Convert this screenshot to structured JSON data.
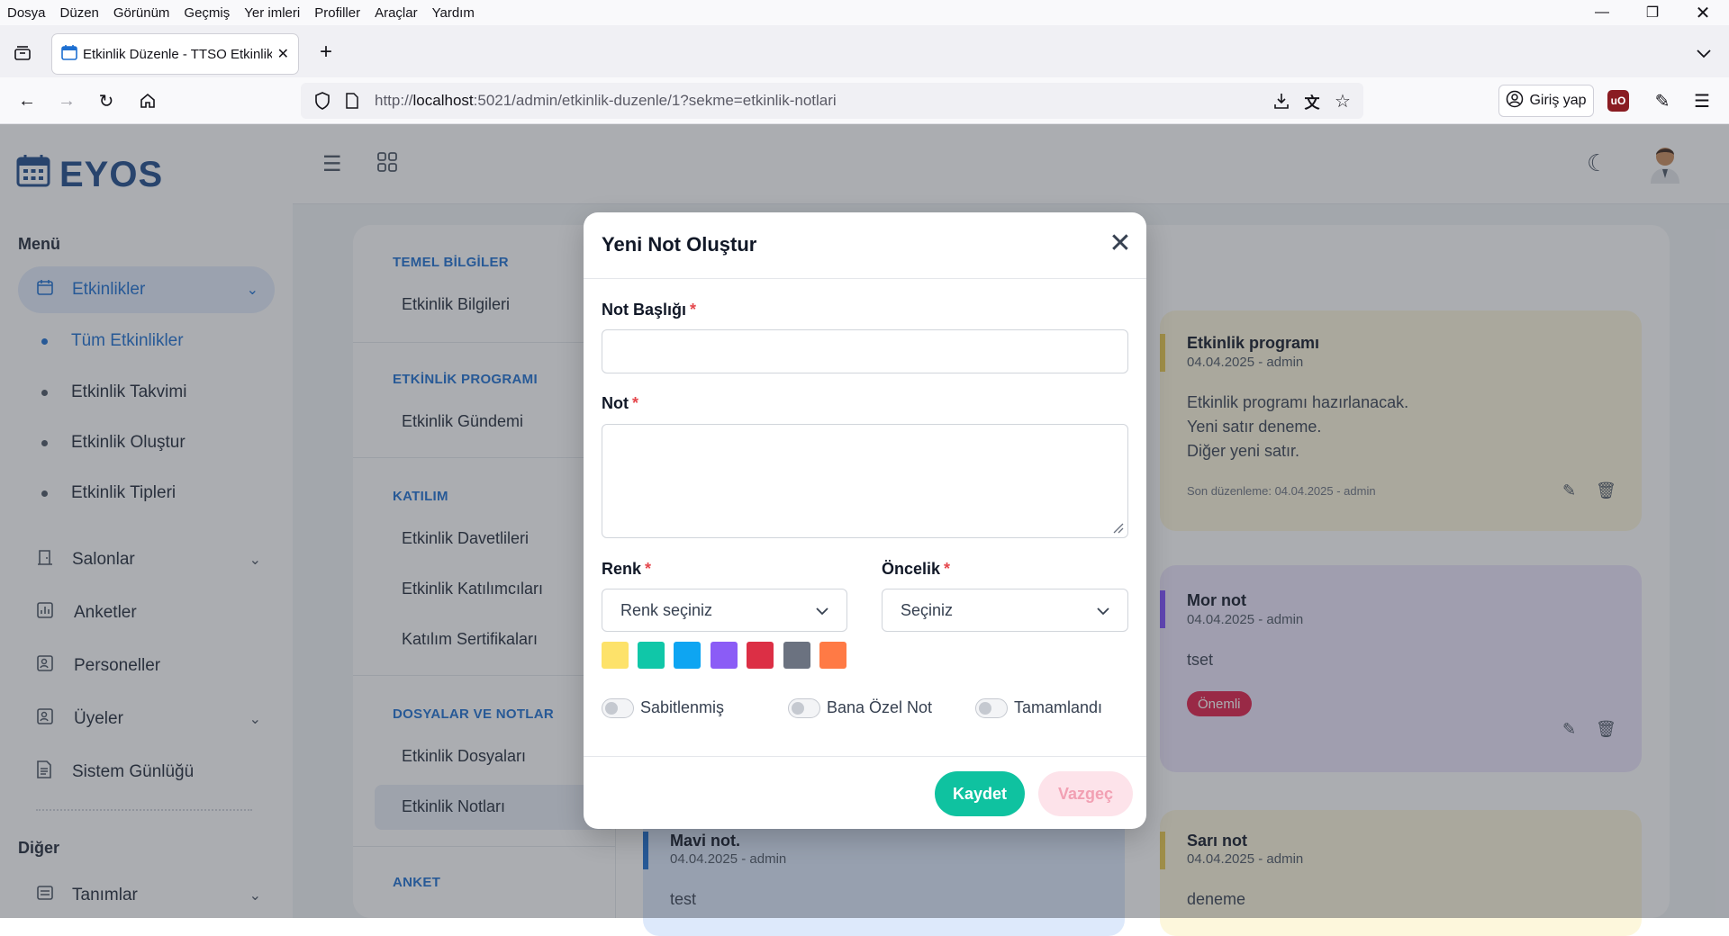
{
  "browser": {
    "menu": [
      "Dosya",
      "Düzen",
      "Görünüm",
      "Geçmiş",
      "Yer imleri",
      "Profiller",
      "Araçlar",
      "Yardım"
    ],
    "tab_title": "Etkinlik Düzenle - TTSO Etkinlik",
    "url_prefix": "http://",
    "url_host": "localhost",
    "url_rest": ":5021/admin/etkinlik-duzenle/1?sekme=etkinlik-notlari",
    "signin_label": "Giriş yap"
  },
  "app": {
    "logo": "EYOS",
    "menu_heading": "Menü",
    "other_heading": "Diğer",
    "sidebar": {
      "etkinlikler": "Etkinlikler",
      "tum": "Tüm Etkinlikler",
      "takvim": "Etkinlik Takvimi",
      "olustur": "Etkinlik Oluştur",
      "tipler": "Etkinlik Tipleri",
      "salonlar": "Salonlar",
      "anketler": "Anketler",
      "personeller": "Personeller",
      "uyeler": "Üyeler",
      "gunluk": "Sistem Günlüğü",
      "tanimlar": "Tanımlar"
    }
  },
  "leftnav": {
    "h1": "TEMEL BİLGİLER",
    "i1": "Etkinlik Bilgileri",
    "h2": "ETKİNLİK PROGRAMI",
    "i2": "Etkinlik Gündemi",
    "h3": "KATILIM",
    "i3a": "Etkinlik Davetlileri",
    "i3b": "Etkinlik Katılımcıları",
    "i3c": "Katılım Sertifikaları",
    "h4": "DOSYALAR VE NOTLAR",
    "i4a": "Etkinlik Dosyaları",
    "i4b": "Etkinlik Notları",
    "h5": "ANKET"
  },
  "notes": {
    "n1": {
      "title": "Etkinlik programı",
      "meta": "04.04.2025  - admin",
      "l1": "Etkinlik programı hazırlanacak.",
      "l2": "Yeni satır deneme.",
      "l3": "Diğer yeni satır.",
      "edited": "Son düzenleme: 04.04.2025  - admin",
      "color": "#e8c94a"
    },
    "n2": {
      "title": "Mor not",
      "meta": "04.04.2025  - admin",
      "body": "tset",
      "badge": "Önemli",
      "color": "#7c4dff"
    },
    "n3": {
      "title": "Mavi not.",
      "meta": "04.04.2025  - admin",
      "body": "test",
      "color": "#1d6fd1"
    },
    "n4": {
      "title": "Sarı not",
      "meta": "04.04.2025  - admin",
      "body": "deneme",
      "color": "#e8c94a"
    }
  },
  "modal": {
    "title": "Yeni Not Oluştur",
    "title_label": "Not Başlığı",
    "note_label": "Not",
    "color_label": "Renk",
    "color_placeholder": "Renk seçiniz",
    "priority_label": "Öncelik",
    "priority_placeholder": "Seçiniz",
    "required_mark": "*",
    "swatches": [
      "#fde26a",
      "#10c7a8",
      "#0ea5f2",
      "#8b5cf6",
      "#dc2f45",
      "#6b7280",
      "#ff7a45"
    ],
    "toggle_pinned": "Sabitlenmiş",
    "toggle_private": "Bana Özel Not",
    "toggle_done": "Tamamlandı",
    "save": "Kaydet",
    "cancel": "Vazgeç"
  }
}
